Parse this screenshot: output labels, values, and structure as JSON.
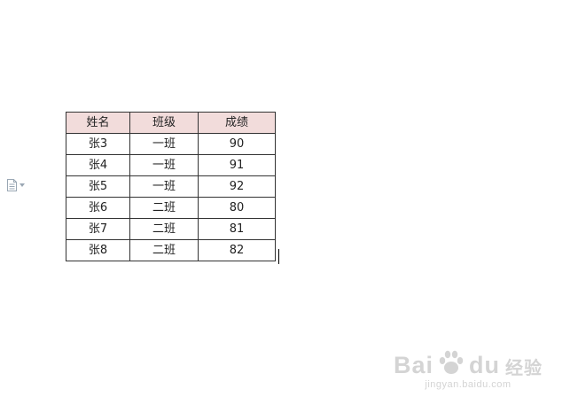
{
  "table": {
    "headers": [
      "姓名",
      "班级",
      "成绩"
    ],
    "rows": [
      [
        "张3",
        "一班",
        "90"
      ],
      [
        "张4",
        "一班",
        "91"
      ],
      [
        "张5",
        "一班",
        "92"
      ],
      [
        "张6",
        "二班",
        "80"
      ],
      [
        "张7",
        "二班",
        "81"
      ],
      [
        "张8",
        "二班",
        "82"
      ]
    ]
  },
  "colors": {
    "header_background": "#f2dcdb",
    "border": "#333333",
    "watermark": "#d4d4d4"
  },
  "icons": {
    "paste_options": "document-icon",
    "paste_options_caret": "chevron-down-icon",
    "watermark_logo": "paw-icon"
  },
  "watermark": {
    "brand_left": "Bai",
    "brand_right": "du",
    "sub": "经验",
    "url": "jingyan.baidu.com"
  }
}
